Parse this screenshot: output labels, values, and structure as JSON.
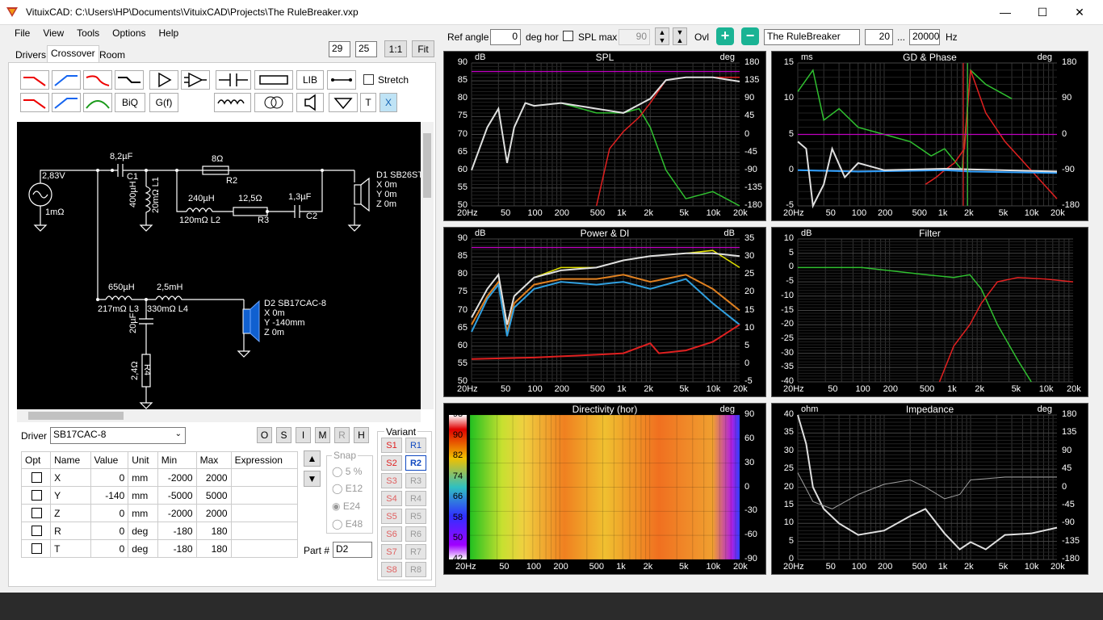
{
  "window": {
    "title": "VituixCAD: C:\\Users\\HP\\Documents\\VituixCAD\\Projects\\The RuleBreaker.vxp",
    "minimize": "—",
    "maximize": "☐",
    "close": "✕"
  },
  "menu": [
    "File",
    "View",
    "Tools",
    "Options",
    "Help"
  ],
  "tabs": [
    "Drivers",
    "Crossover",
    "Room"
  ],
  "zoom": {
    "w": "29",
    "h": "25",
    "one": "1:1",
    "fit": "Fit"
  },
  "tools": {
    "lib": "LIB",
    "biq": "BiQ",
    "gf": "G(f)",
    "t": "T",
    "x": "X",
    "stretch": "Stretch"
  },
  "top": {
    "ref_angle_label": "Ref angle",
    "ref_angle": "0",
    "deg_hor": "deg hor",
    "spl_max": "SPL max",
    "spl_max_val": "90",
    "ovl": "Ovl",
    "name": "The RuleBreaker",
    "f_from": "20",
    "dots": "...",
    "f_to": "20000",
    "hz": "Hz"
  },
  "schematic": {
    "source_v": "2,83V",
    "source_r": "1mΩ",
    "c1_val": "8,2µF",
    "c1": "C1",
    "l1_val": "400µH",
    "l1": "20mΩ L1",
    "r2_val": "8Ω",
    "r2": "R2",
    "l2_val": "240µH",
    "l2": "120mΩ L2",
    "r3_val": "12,5Ω",
    "r3": "R3",
    "c2_val": "1,3µF",
    "c2": "C2",
    "d1": [
      "D1 SB26ST",
      "X 0m",
      "Y 0m",
      "Z 0m"
    ],
    "l3_val": "650µH",
    "l3": "217mΩ L3",
    "l4_val": "2,5mH",
    "l4": "330mΩ L4",
    "c3_val": "20µF",
    "r4_val": "2,4Ω",
    "r4": "R4",
    "d2": [
      "D2 SB17CAC-8",
      "X 0m",
      "Y -140mm",
      "Z 0m"
    ]
  },
  "driver": {
    "label": "Driver",
    "value": "SB17CAC-8",
    "buttons": [
      "O",
      "S",
      "I",
      "M",
      "R",
      "H"
    ]
  },
  "props": {
    "headers": [
      "Opt",
      "Name",
      "Value",
      "Unit",
      "Min",
      "Max",
      "Expression"
    ],
    "rows": [
      [
        "X",
        "0",
        "mm",
        "-2000",
        "2000"
      ],
      [
        "Y",
        "-140",
        "mm",
        "-5000",
        "5000"
      ],
      [
        "Z",
        "0",
        "mm",
        "-2000",
        "2000"
      ],
      [
        "R",
        "0",
        "deg",
        "-180",
        "180"
      ],
      [
        "T",
        "0",
        "deg",
        "-180",
        "180"
      ]
    ]
  },
  "snap": {
    "label": "Snap",
    "options": [
      "5 %",
      "E12",
      "E24",
      "E48"
    ],
    "selected": "E24"
  },
  "part": {
    "label": "Part #",
    "value": "D2"
  },
  "variant": {
    "label": "Variant",
    "s": [
      "S1",
      "S2",
      "S3",
      "S4",
      "S5",
      "S6",
      "S7",
      "S8"
    ],
    "r": [
      "R1",
      "R2",
      "R3",
      "R4",
      "R5",
      "R6",
      "R7",
      "R8"
    ],
    "active_r": "R2"
  },
  "freq_ticks": [
    "20Hz",
    "50",
    "100",
    "200",
    "500",
    "1k",
    "2k",
    "5k",
    "10k",
    "20k"
  ],
  "graphs": {
    "spl": {
      "title": "SPL",
      "ul": "dB",
      "ur": "deg",
      "left": [
        "90",
        "85",
        "80",
        "75",
        "70",
        "65",
        "60",
        "55",
        "50"
      ],
      "right": [
        "180",
        "135",
        "90",
        "45",
        "0",
        "-45",
        "-90",
        "-135",
        "-180"
      ]
    },
    "gd": {
      "title": "GD & Phase",
      "ul": "ms",
      "ur": "deg",
      "left": [
        "15",
        "10",
        "5",
        "0",
        "-5"
      ],
      "right": [
        "180",
        "90",
        "0",
        "-90",
        "-180"
      ]
    },
    "power": {
      "title": "Power & DI",
      "ul": "dB",
      "ur": "dB",
      "left": [
        "90",
        "85",
        "80",
        "75",
        "70",
        "65",
        "60",
        "55",
        "50"
      ],
      "right": [
        "35",
        "30",
        "25",
        "20",
        "15",
        "10",
        "5",
        "0",
        "-5"
      ]
    },
    "filter": {
      "title": "Filter",
      "ul": "dB",
      "left": [
        "10",
        "5",
        "0",
        "-5",
        "-10",
        "-15",
        "-20",
        "-25",
        "-30",
        "-35",
        "-40"
      ]
    },
    "dir": {
      "title": "Directivity (hor)",
      "ur": "deg",
      "scale": [
        "98",
        "90",
        "82",
        "74",
        "66",
        "58",
        "50",
        "42"
      ],
      "right": [
        "90",
        "60",
        "30",
        "0",
        "-30",
        "-60",
        "-90"
      ]
    },
    "imp": {
      "title": "Impedance",
      "ul": "ohm",
      "ur": "deg",
      "left": [
        "40",
        "35",
        "30",
        "25",
        "20",
        "15",
        "10",
        "5",
        "0"
      ],
      "right": [
        "180",
        "135",
        "90",
        "45",
        "0",
        "-45",
        "-90",
        "-135",
        "-180"
      ]
    }
  }
}
